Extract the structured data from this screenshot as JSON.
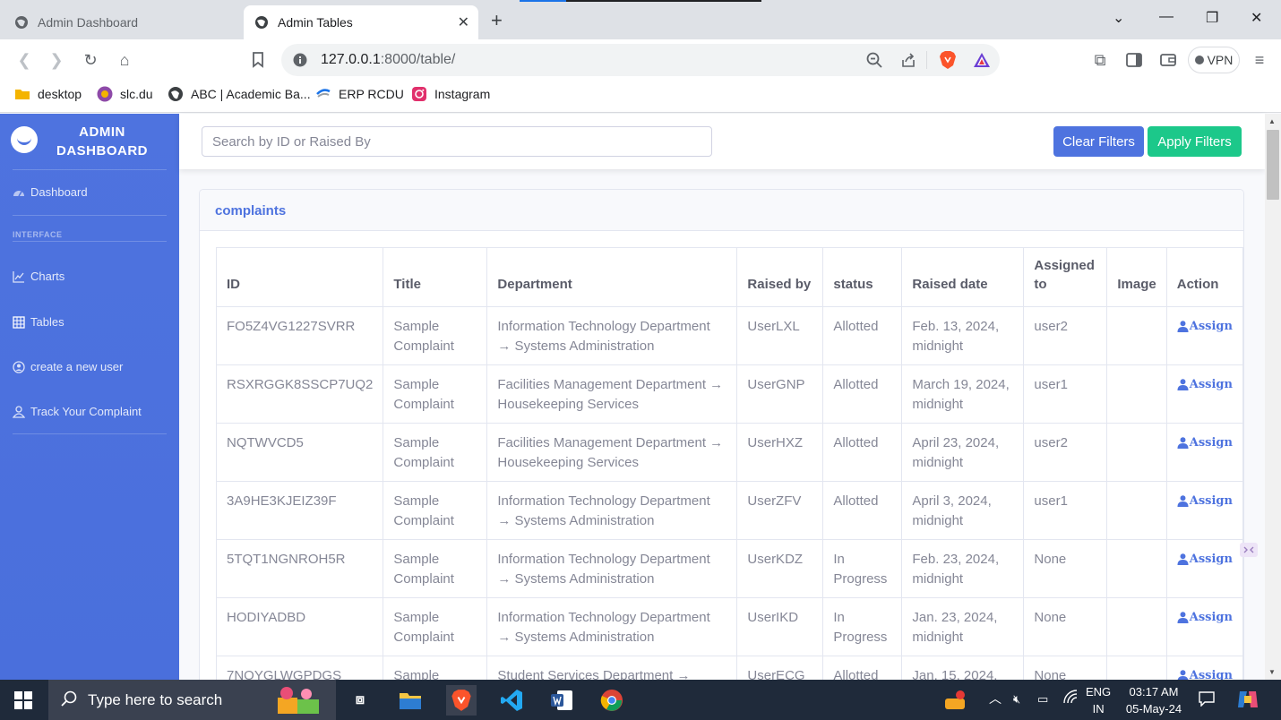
{
  "browser": {
    "tabs": [
      {
        "title": "Admin Dashboard",
        "active": false
      },
      {
        "title": "Admin Tables",
        "active": true
      }
    ],
    "url_host": "127.0.0.1",
    "url_path": ":8000/table/",
    "vpn_label": "VPN",
    "bookmarks": [
      {
        "label": "desktop",
        "icon": "folder-icon",
        "color": "#f4b400"
      },
      {
        "label": "slc.du",
        "icon": "slc-icon",
        "color": "#8e4aa8"
      },
      {
        "label": "ABC | Academic Ba...",
        "icon": "globe-icon",
        "color": "#3c4043"
      },
      {
        "label": "ERP RCDU",
        "icon": "erp-icon",
        "color": "#1a73e8"
      },
      {
        "label": "Instagram",
        "icon": "instagram-icon",
        "color": "#e1306c"
      }
    ]
  },
  "sidebar": {
    "brand": "ADMIN DASHBOARD",
    "dashboard": "Dashboard",
    "heading": "INTERFACE",
    "items": [
      {
        "label": "Charts",
        "icon": "chart-icon"
      },
      {
        "label": "Tables",
        "icon": "table-icon"
      },
      {
        "label": "create a new user",
        "icon": "user-circle-icon"
      },
      {
        "label": "Track Your Complaint",
        "icon": "user-icon"
      }
    ],
    "color": "#4e73df"
  },
  "filters": {
    "search_placeholder": "Search by ID or Raised By",
    "clear_label": "Clear Filters",
    "apply_label": "Apply Filters"
  },
  "card": {
    "title": "complaints"
  },
  "table": {
    "headers": [
      "ID",
      "Title",
      "Department",
      "Raised by",
      "status",
      "Raised date",
      "Assigned to",
      "Image",
      "Action"
    ],
    "rows": [
      {
        "id": "FO5Z4VG1227SVRR",
        "title": "Sample Complaint",
        "department": "Information Technology Department → Systems Administration",
        "raised_by": "UserLXL",
        "status": "Allotted",
        "date": "Feb. 13, 2024, midnight",
        "assigned": "user2",
        "image": "",
        "action": "Assign"
      },
      {
        "id": "RSXRGGK8SSCP7UQ2",
        "title": "Sample Complaint",
        "department": "Facilities Management Department → Housekeeping Services",
        "raised_by": "UserGNP",
        "status": "Allotted",
        "date": "March 19, 2024, midnight",
        "assigned": "user1",
        "image": "",
        "action": "Assign"
      },
      {
        "id": "NQTWVCD5",
        "title": "Sample Complaint",
        "department": "Facilities Management Department → Housekeeping Services",
        "raised_by": "UserHXZ",
        "status": "Allotted",
        "date": "April 23, 2024, midnight",
        "assigned": "user2",
        "image": "",
        "action": "Assign"
      },
      {
        "id": "3A9HE3KJEIZ39F",
        "title": "Sample Complaint",
        "department": "Information Technology Department → Systems Administration",
        "raised_by": "UserZFV",
        "status": "Allotted",
        "date": "April 3, 2024, midnight",
        "assigned": "user1",
        "image": "",
        "action": "Assign"
      },
      {
        "id": "5TQT1NGNROH5R",
        "title": "Sample Complaint",
        "department": "Information Technology Department → Systems Administration",
        "raised_by": "UserKDZ",
        "status": "In Progress",
        "date": "Feb. 23, 2024, midnight",
        "assigned": "None",
        "image": "",
        "action": "Assign"
      },
      {
        "id": "HODIYADBD",
        "title": "Sample Complaint",
        "department": "Information Technology Department → Systems Administration",
        "raised_by": "UserIKD",
        "status": "In Progress",
        "date": "Jan. 23, 2024, midnight",
        "assigned": "None",
        "image": "",
        "action": "Assign"
      },
      {
        "id": "7NOYGLWGPDGS",
        "title": "Sample",
        "department": "Student Services Department → Career",
        "raised_by": "UserECG",
        "status": "Allotted",
        "date": "Jan. 15, 2024,",
        "assigned": "None",
        "image": "",
        "action": "Assign"
      }
    ]
  },
  "taskbar": {
    "search_placeholder": "Type here to search",
    "lang_top": "ENG",
    "lang_bottom": "IN",
    "time": "03:17 AM",
    "date": "05-May-24"
  }
}
